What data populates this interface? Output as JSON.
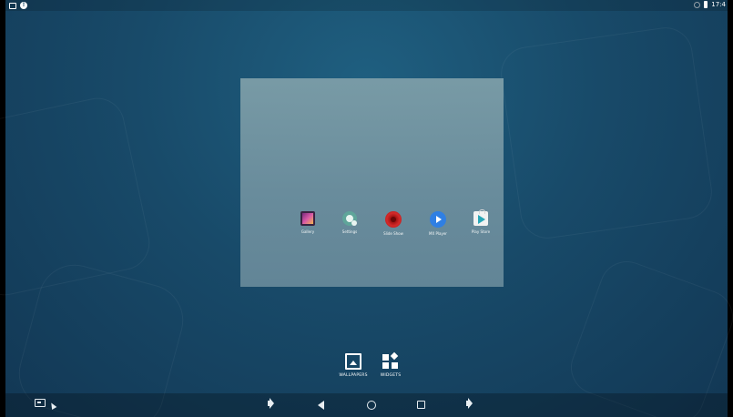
{
  "status_bar": {
    "left_icons": [
      "screen-capture-icon",
      "info-icon"
    ],
    "info_glyph": "!",
    "right_icons": [
      "wifi-icon",
      "battery-icon"
    ],
    "time": "17:4"
  },
  "preview": {
    "apps": [
      {
        "label": "Gallery",
        "icon": "gallery-icon"
      },
      {
        "label": "Settings",
        "icon": "settings-icon"
      },
      {
        "label": "Slide Show",
        "icon": "slideshow-icon"
      },
      {
        "label": "MX Player",
        "icon": "mx-player-icon"
      },
      {
        "label": "Play Store",
        "icon": "play-store-icon"
      }
    ]
  },
  "options": {
    "wallpapers": "WALLPAPERS",
    "widgets": "WIDGETS"
  },
  "nav_bar": {
    "buttons": [
      "screenshot-icon",
      "volume-down-icon",
      "back-icon",
      "home-icon",
      "recent-apps-icon",
      "volume-up-icon"
    ]
  },
  "colors": {
    "wallpaper": "#184a69",
    "preview_card": "#7d9ea8",
    "mx_player": "#2f7fe3",
    "slide_show": "#d42a2a"
  }
}
